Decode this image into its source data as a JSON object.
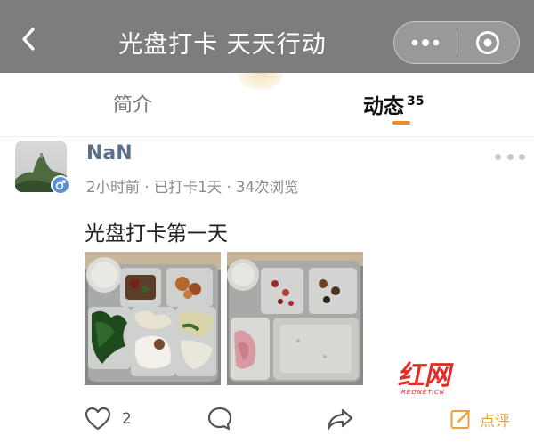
{
  "navbar": {
    "title": "光盘打卡 天天行动",
    "back_icon": "chevron-left-icon",
    "more_icon": "more-dots-icon",
    "close_icon": "target-circle-icon"
  },
  "tabs": [
    {
      "label": "简介",
      "active": false
    },
    {
      "label": "动态",
      "active": true,
      "count": "35"
    }
  ],
  "post": {
    "username": "NaN",
    "meta": "2小时前 · 已打卡1天 · 34次浏览",
    "text": "光盘打卡第一天",
    "gender_icon": "male-icon",
    "images": [
      "food-tray-full-photo",
      "food-tray-empty-photo"
    ]
  },
  "actions": {
    "like_count": "2",
    "review_label": "点评"
  },
  "colors": {
    "navbar_bg": "#7d7d7d",
    "accent": "#f08b2c",
    "username": "#5b6f8a",
    "review": "#e8a33a",
    "watermark_red": "#e52d27"
  }
}
